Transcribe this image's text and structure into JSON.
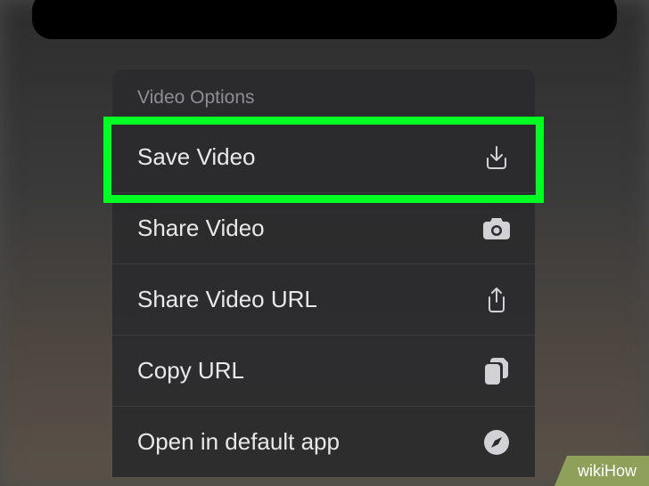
{
  "sheet": {
    "title": "Video Options",
    "items": [
      {
        "label": "Save Video",
        "icon": "download-icon"
      },
      {
        "label": "Share Video",
        "icon": "camera-icon"
      },
      {
        "label": "Share Video URL",
        "icon": "share-icon"
      },
      {
        "label": "Copy URL",
        "icon": "copy-icon"
      },
      {
        "label": "Open in default app",
        "icon": "compass-icon"
      }
    ]
  },
  "highlight": {
    "color": "#00ff22"
  },
  "watermark": "wikiHow"
}
